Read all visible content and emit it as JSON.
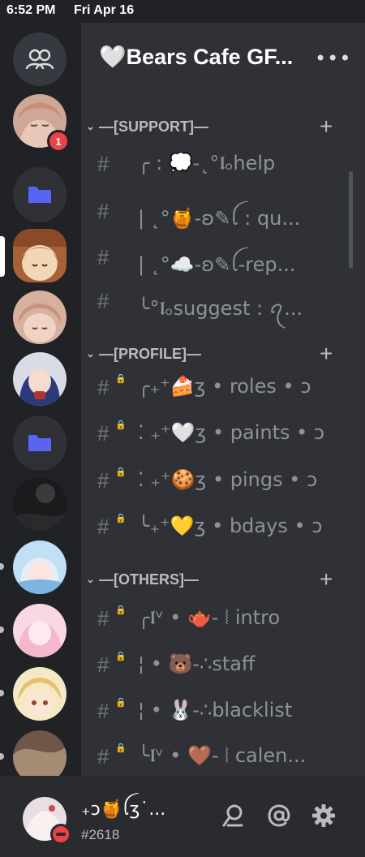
{
  "status": {
    "time": "6:52 PM",
    "date": "Fri Apr 16"
  },
  "rail": {
    "badge_count": "1",
    "colors": {
      "accent": "#5865f2",
      "mention": "#ed4245"
    }
  },
  "guild": {
    "name": "🤍Bears Cafe GF...",
    "more": "•••"
  },
  "categories": [
    {
      "name": "—[SUPPORT]—",
      "plus": "+",
      "channels": [
        {
          "hash": "#",
          "name": "╭ : 💭-˛°𝖑ₒhelp"
        },
        {
          "hash": "#",
          "name": "| ˛°🍯-ʚ✎ꪶ : qu..."
        },
        {
          "hash": "#",
          "name": "| ˛°☁️-ʚ✎ꪶ-rep..."
        },
        {
          "hash": "#",
          "name": "╰°𝖑ₒsuggest : ꪖ..."
        }
      ]
    },
    {
      "name": "—[PROFILE]—",
      "plus": "+",
      "channels": [
        {
          "hash": "#",
          "name": "╭₊⁺🍰ʒ • roles • ɔ"
        },
        {
          "hash": "#",
          "name": "⁚ ₊⁺🤍ʒ • paints • ɔ"
        },
        {
          "hash": "#",
          "name": "⁚ ₊⁺🍪ʒ • pings • ɔ"
        },
        {
          "hash": "#",
          "name": "╰₊⁺💛ʒ • bdays • ɔ"
        }
      ]
    },
    {
      "name": "—[OTHERS]—",
      "plus": "+",
      "channels": [
        {
          "hash": "#",
          "name": "╭𝖑ᵛ • 🫖- ⦚ intro"
        },
        {
          "hash": "#",
          "name": "¦ • 🐻-∴staff"
        },
        {
          "hash": "#",
          "name": "¦ • 🐰-∴blacklist"
        },
        {
          "hash": "#",
          "name": "╰𝖑ᵛ • 🤎- ⦚ calen..."
        }
      ]
    }
  ],
  "user": {
    "name": "₊ɔ🍯ꪶʒ˙...",
    "tag": "#2618"
  }
}
